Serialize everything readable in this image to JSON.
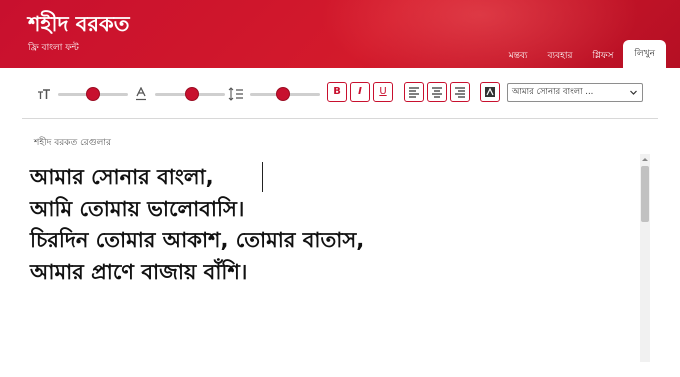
{
  "app": {
    "title": "শহীদ বরকত",
    "subtitle": "ফ্রি বাংলা ফন্ট"
  },
  "nav": {
    "tabs": [
      {
        "label": "মন্তব্য",
        "active": false
      },
      {
        "label": "ব্যবহার",
        "active": false
      },
      {
        "label": "গ্লিফস",
        "active": false
      },
      {
        "label": "লিখুন",
        "active": true
      }
    ]
  },
  "toolbar": {
    "sliders": [
      {
        "name": "font-size",
        "icon": "text-size-icon",
        "value": 0.5
      },
      {
        "name": "letter-spacing",
        "icon": "letter-spacing-icon",
        "value": 0.5
      },
      {
        "name": "line-height",
        "icon": "line-height-icon",
        "value": 0.5
      }
    ],
    "bold_label": "B",
    "italic_label": "I",
    "underline_label": "U",
    "align_left_icon": "align-left-icon",
    "align_center_icon": "align-center-icon",
    "align_right_icon": "align-right-icon",
    "color_icon": "color-picker-icon",
    "sample_select_value": "আমার সোনার বাংলা ..."
  },
  "editor": {
    "font_name": "শহীদ বরকত রেগুলার",
    "lines": [
      "আমার সোনার বাংলা,",
      "আমি তোমায় ভালোবাসি।",
      "চিরদিন তোমার আকাশ, তোমার বাতাস,",
      "আমার প্রাণে বাজায় বাঁশি।"
    ]
  },
  "colors": {
    "brand_red": "#c8102e",
    "text": "#111111"
  }
}
